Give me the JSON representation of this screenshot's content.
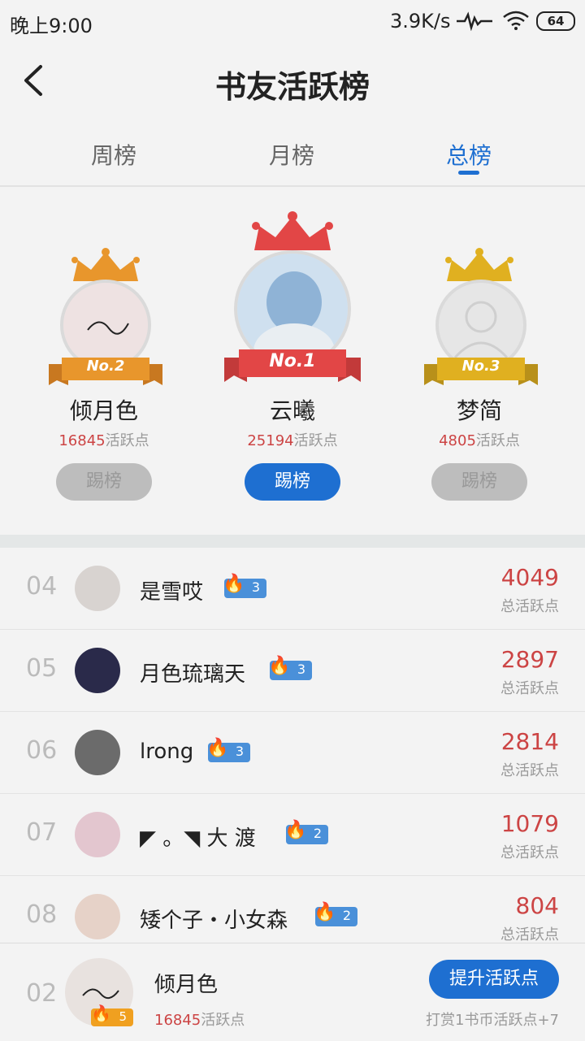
{
  "status_bar": {
    "time": "晚上9:00",
    "network_speed": "3.9K/s",
    "battery": "64"
  },
  "header": {
    "title": "书友活跃榜"
  },
  "tabs": [
    {
      "label": "周榜",
      "active": false
    },
    {
      "label": "月榜",
      "active": false
    },
    {
      "label": "总榜",
      "active": true
    }
  ],
  "podium": {
    "points_suffix": "活跃点",
    "kick_label": "踢榜",
    "first": {
      "rank_label": "No.1",
      "name": "云曦",
      "points": "25194"
    },
    "second": {
      "rank_label": "No.2",
      "name": "倾月色",
      "points": "16845"
    },
    "third": {
      "rank_label": "No.3",
      "name": "梦简",
      "points": "4805"
    }
  },
  "list": {
    "score_caption": "总活跃点",
    "rows": [
      {
        "rank": "04",
        "name": "是雪哎",
        "level": "3",
        "score": "4049"
      },
      {
        "rank": "05",
        "name": "月色琉璃天",
        "level": "3",
        "score": "2897"
      },
      {
        "rank": "06",
        "name": "lrong",
        "level": "3",
        "score": "2814"
      },
      {
        "rank": "07",
        "name": "◤ 。◥ 大 渡",
        "level": "2",
        "score": "1079"
      },
      {
        "rank": "08",
        "name": "矮个子・小女森",
        "level": "2",
        "score": "804"
      }
    ]
  },
  "footer": {
    "rank": "02",
    "name": "倾月色",
    "points": "16845",
    "points_suffix": "活跃点",
    "level": "5",
    "boost_button": "提升活跃点",
    "boost_note": "打赏1书币活跃点+7"
  },
  "colors": {
    "accent": "#1e6fd1",
    "score": "#c44444",
    "badge": "#4a90d9"
  }
}
